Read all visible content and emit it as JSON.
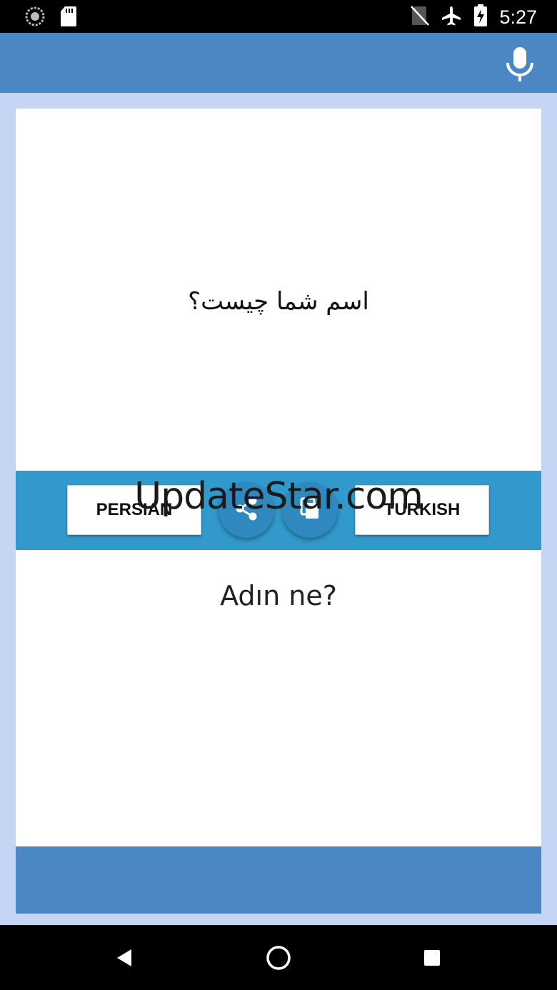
{
  "status_bar": {
    "time": "5:27",
    "icons": [
      "sync-icon",
      "sd-card-icon",
      "no-sim-icon",
      "airplane-icon",
      "battery-charging-icon"
    ]
  },
  "app_bar": {
    "mic_icon": "microphone-icon",
    "color": "#4a87c4"
  },
  "source": {
    "text": "اسم شما چیست؟"
  },
  "controls": {
    "source_language": "PERSIAN",
    "target_language": "TURKISH",
    "share_icon": "share-icon",
    "copy_icon": "copy-icon",
    "bar_color": "#3199cc"
  },
  "watermark": "UpdateStar.com",
  "target": {
    "text": "Adın ne?"
  },
  "nav_bar": {
    "icons": [
      "back-icon",
      "home-icon",
      "recents-icon"
    ]
  }
}
